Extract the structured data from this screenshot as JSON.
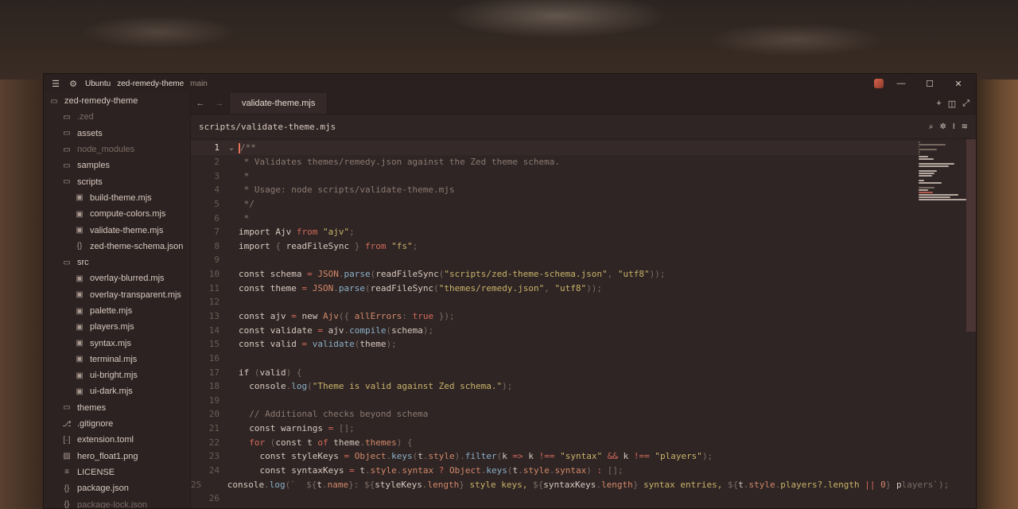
{
  "titlebar": {
    "os": "Ubuntu",
    "project": "zed-remedy-theme",
    "branch": "main"
  },
  "sidebar": {
    "items": [
      {
        "label": "zed-remedy-theme",
        "icon": "folder-open-icon",
        "depth": 0,
        "dim": false
      },
      {
        "label": ".zed",
        "icon": "folder-icon",
        "depth": 1,
        "dim": true
      },
      {
        "label": "assets",
        "icon": "folder-icon",
        "depth": 1,
        "dim": false
      },
      {
        "label": "node_modules",
        "icon": "folder-icon",
        "depth": 1,
        "dim": true
      },
      {
        "label": "samples",
        "icon": "folder-icon",
        "depth": 1,
        "dim": false
      },
      {
        "label": "scripts",
        "icon": "folder-open-icon",
        "depth": 1,
        "dim": false
      },
      {
        "label": "build-theme.mjs",
        "icon": "js-file-icon",
        "depth": 2,
        "dim": false
      },
      {
        "label": "compute-colors.mjs",
        "icon": "js-file-icon",
        "depth": 2,
        "dim": false
      },
      {
        "label": "validate-theme.mjs",
        "icon": "js-file-icon",
        "depth": 2,
        "dim": false
      },
      {
        "label": "zed-theme-schema.json",
        "icon": "json-file-icon",
        "depth": 2,
        "dim": false
      },
      {
        "label": "src",
        "icon": "folder-open-icon",
        "depth": 1,
        "dim": false
      },
      {
        "label": "overlay-blurred.mjs",
        "icon": "js-file-icon",
        "depth": 2,
        "dim": false
      },
      {
        "label": "overlay-transparent.mjs",
        "icon": "js-file-icon",
        "depth": 2,
        "dim": false
      },
      {
        "label": "palette.mjs",
        "icon": "js-file-icon",
        "depth": 2,
        "dim": false
      },
      {
        "label": "players.mjs",
        "icon": "js-file-icon",
        "depth": 2,
        "dim": false
      },
      {
        "label": "syntax.mjs",
        "icon": "js-file-icon",
        "depth": 2,
        "dim": false
      },
      {
        "label": "terminal.mjs",
        "icon": "js-file-icon",
        "depth": 2,
        "dim": false
      },
      {
        "label": "ui-bright.mjs",
        "icon": "js-file-icon",
        "depth": 2,
        "dim": false
      },
      {
        "label": "ui-dark.mjs",
        "icon": "js-file-icon",
        "depth": 2,
        "dim": false
      },
      {
        "label": "themes",
        "icon": "folder-icon",
        "depth": 1,
        "dim": false
      },
      {
        "label": ".gitignore",
        "icon": "git-icon",
        "depth": 1,
        "dim": false
      },
      {
        "label": "extension.toml",
        "icon": "toml-file-icon",
        "depth": 1,
        "dim": false
      },
      {
        "label": "hero_float1.png",
        "icon": "image-file-icon",
        "depth": 1,
        "dim": false
      },
      {
        "label": "LICENSE",
        "icon": "license-file-icon",
        "depth": 1,
        "dim": false
      },
      {
        "label": "package.json",
        "icon": "json-file-icon",
        "depth": 1,
        "dim": false
      },
      {
        "label": "package-lock.json",
        "icon": "json-file-icon",
        "depth": 1,
        "dim": true
      }
    ]
  },
  "tabs": [
    {
      "label": "validate-theme.mjs",
      "active": true
    }
  ],
  "breadcrumb": "scripts/validate-theme.mjs",
  "colors": {
    "keyword": "#d36a5a",
    "string": "#c9b36a",
    "comment": "#8a7a72",
    "func": "#8ab0c8",
    "prop": "#d3896a",
    "plain": "#d8c9c0",
    "punct": "#7b6c65",
    "accent": "#e8735a"
  },
  "code": [
    {
      "n": "1",
      "fold": "chevron-down-icon",
      "tokens": [
        [
          "/**",
          "comment"
        ]
      ]
    },
    {
      "n": "2",
      "tokens": [
        [
          " * Validates themes/remedy.json against the Zed theme schema.",
          "comment"
        ]
      ]
    },
    {
      "n": "3",
      "tokens": [
        [
          " *",
          "comment"
        ]
      ]
    },
    {
      "n": "4",
      "tokens": [
        [
          " * Usage: node scripts/validate-theme.mjs",
          "comment"
        ]
      ]
    },
    {
      "n": "5",
      "tokens": [
        [
          " */",
          "comment"
        ]
      ]
    },
    {
      "n": "6",
      "tokens": [
        [
          " *",
          "comment"
        ]
      ]
    },
    {
      "n": "7",
      "tokens": [
        [
          "import ",
          "plain"
        ],
        [
          "Ajv ",
          "plain"
        ],
        [
          "from ",
          "keyword"
        ],
        [
          "\"ajv\"",
          "string"
        ],
        [
          ";",
          "punct"
        ]
      ]
    },
    {
      "n": "8",
      "tokens": [
        [
          "import ",
          "plain"
        ],
        [
          "{ ",
          "punct"
        ],
        [
          "readFileSync ",
          "plain"
        ],
        [
          "} ",
          "punct"
        ],
        [
          "from ",
          "keyword"
        ],
        [
          "\"fs\"",
          "string"
        ],
        [
          ";",
          "punct"
        ]
      ]
    },
    {
      "n": "9",
      "tokens": []
    },
    {
      "n": "10",
      "tokens": [
        [
          "const ",
          "plain"
        ],
        [
          "schema ",
          "plain"
        ],
        [
          "= ",
          "keyword"
        ],
        [
          "JSON",
          "prop"
        ],
        [
          ".",
          "punct"
        ],
        [
          "parse",
          "func"
        ],
        [
          "(",
          "punct"
        ],
        [
          "readFileSync",
          "plain"
        ],
        [
          "(",
          "punct"
        ],
        [
          "\"scripts/zed-theme-schema.json\"",
          "string"
        ],
        [
          ", ",
          "punct"
        ],
        [
          "\"utf8\"",
          "string"
        ],
        [
          "));",
          "punct"
        ]
      ]
    },
    {
      "n": "11",
      "tokens": [
        [
          "const ",
          "plain"
        ],
        [
          "theme ",
          "plain"
        ],
        [
          "= ",
          "keyword"
        ],
        [
          "JSON",
          "prop"
        ],
        [
          ".",
          "punct"
        ],
        [
          "parse",
          "func"
        ],
        [
          "(",
          "punct"
        ],
        [
          "readFileSync",
          "plain"
        ],
        [
          "(",
          "punct"
        ],
        [
          "\"themes/remedy.json\"",
          "string"
        ],
        [
          ", ",
          "punct"
        ],
        [
          "\"utf8\"",
          "string"
        ],
        [
          "));",
          "punct"
        ]
      ]
    },
    {
      "n": "12",
      "tokens": []
    },
    {
      "n": "13",
      "tokens": [
        [
          "const ",
          "plain"
        ],
        [
          "ajv ",
          "plain"
        ],
        [
          "= ",
          "keyword"
        ],
        [
          "new ",
          "plain"
        ],
        [
          "Ajv",
          "prop"
        ],
        [
          "({ ",
          "punct"
        ],
        [
          "allErrors",
          "prop"
        ],
        [
          ": ",
          "punct"
        ],
        [
          "true ",
          "keyword"
        ],
        [
          "});",
          "punct"
        ]
      ]
    },
    {
      "n": "14",
      "tokens": [
        [
          "const ",
          "plain"
        ],
        [
          "validate ",
          "plain"
        ],
        [
          "= ",
          "keyword"
        ],
        [
          "ajv",
          "plain"
        ],
        [
          ".",
          "punct"
        ],
        [
          "compile",
          "func"
        ],
        [
          "(",
          "punct"
        ],
        [
          "schema",
          "plain"
        ],
        [
          ");",
          "punct"
        ]
      ]
    },
    {
      "n": "15",
      "tokens": [
        [
          "const ",
          "plain"
        ],
        [
          "valid ",
          "plain"
        ],
        [
          "= ",
          "keyword"
        ],
        [
          "validate",
          "func"
        ],
        [
          "(",
          "punct"
        ],
        [
          "theme",
          "plain"
        ],
        [
          ");",
          "punct"
        ]
      ]
    },
    {
      "n": "16",
      "tokens": []
    },
    {
      "n": "17",
      "tokens": [
        [
          "if ",
          "plain"
        ],
        [
          "(",
          "punct"
        ],
        [
          "valid",
          "plain"
        ],
        [
          ") {",
          "punct"
        ]
      ]
    },
    {
      "n": "18",
      "tokens": [
        [
          "  console",
          "plain"
        ],
        [
          ".",
          "punct"
        ],
        [
          "log",
          "func"
        ],
        [
          "(",
          "punct"
        ],
        [
          "\"Theme is valid against Zed schema.\"",
          "string"
        ],
        [
          ");",
          "punct"
        ]
      ]
    },
    {
      "n": "19",
      "tokens": []
    },
    {
      "n": "20",
      "tokens": [
        [
          "  // Additional checks beyond schema",
          "comment"
        ]
      ]
    },
    {
      "n": "21",
      "tokens": [
        [
          "  const ",
          "plain"
        ],
        [
          "warnings ",
          "plain"
        ],
        [
          "= ",
          "keyword"
        ],
        [
          "[];",
          "punct"
        ]
      ]
    },
    {
      "n": "22",
      "tokens": [
        [
          "  for ",
          "keyword"
        ],
        [
          "(",
          "punct"
        ],
        [
          "const ",
          "plain"
        ],
        [
          "t ",
          "plain"
        ],
        [
          "of ",
          "keyword"
        ],
        [
          "theme",
          "plain"
        ],
        [
          ".",
          "punct"
        ],
        [
          "themes",
          "prop"
        ],
        [
          ") {",
          "punct"
        ]
      ]
    },
    {
      "n": "23",
      "tokens": [
        [
          "    const ",
          "plain"
        ],
        [
          "styleKeys ",
          "plain"
        ],
        [
          "= ",
          "keyword"
        ],
        [
          "Object",
          "prop"
        ],
        [
          ".",
          "punct"
        ],
        [
          "keys",
          "func"
        ],
        [
          "(",
          "punct"
        ],
        [
          "t",
          "plain"
        ],
        [
          ".",
          "punct"
        ],
        [
          "style",
          "prop"
        ],
        [
          ").",
          "punct"
        ],
        [
          "filter",
          "func"
        ],
        [
          "(",
          "punct"
        ],
        [
          "k ",
          "plain"
        ],
        [
          "=> ",
          "keyword"
        ],
        [
          "k ",
          "plain"
        ],
        [
          "!== ",
          "keyword"
        ],
        [
          "\"syntax\" ",
          "string"
        ],
        [
          "&& ",
          "keyword"
        ],
        [
          "k ",
          "plain"
        ],
        [
          "!== ",
          "keyword"
        ],
        [
          "\"players\"",
          "string"
        ],
        [
          ");",
          "punct"
        ]
      ]
    },
    {
      "n": "24",
      "tokens": [
        [
          "    const ",
          "plain"
        ],
        [
          "syntaxKeys ",
          "plain"
        ],
        [
          "= ",
          "keyword"
        ],
        [
          "t",
          "plain"
        ],
        [
          ".",
          "punct"
        ],
        [
          "style",
          "prop"
        ],
        [
          ".",
          "punct"
        ],
        [
          "syntax ",
          "prop"
        ],
        [
          "? ",
          "keyword"
        ],
        [
          "Object",
          "prop"
        ],
        [
          ".",
          "punct"
        ],
        [
          "keys",
          "func"
        ],
        [
          "(",
          "punct"
        ],
        [
          "t",
          "plain"
        ],
        [
          ".",
          "punct"
        ],
        [
          "style",
          "prop"
        ],
        [
          ".",
          "punct"
        ],
        [
          "syntax",
          "prop"
        ],
        [
          ") ",
          "punct"
        ],
        [
          ": ",
          "keyword"
        ],
        [
          "[];",
          "punct"
        ]
      ]
    },
    {
      "n": "25",
      "tokens": [
        [
          "    console",
          "plain"
        ],
        [
          ".",
          "punct"
        ],
        [
          "log",
          "func"
        ],
        [
          "(`  ",
          "punct"
        ],
        [
          "${",
          "punct"
        ],
        [
          "t",
          "plain"
        ],
        [
          ".",
          "punct"
        ],
        [
          "name",
          "prop"
        ],
        [
          "}: ",
          "punct"
        ],
        [
          "${",
          "punct"
        ],
        [
          "styleKeys",
          "plain"
        ],
        [
          ".",
          "punct"
        ],
        [
          "length",
          "prop"
        ],
        [
          "} ",
          "punct"
        ],
        [
          "style keys, ",
          "string"
        ],
        [
          "${",
          "punct"
        ],
        [
          "syntaxKeys",
          "plain"
        ],
        [
          ".",
          "punct"
        ],
        [
          "length",
          "prop"
        ],
        [
          "} ",
          "punct"
        ],
        [
          "syntax entries, ",
          "string"
        ],
        [
          "${",
          "punct"
        ],
        [
          "t",
          "plain"
        ],
        [
          ".",
          "punct"
        ],
        [
          "style",
          "prop"
        ],
        [
          ".",
          "punct"
        ],
        [
          "players?.length ",
          "string"
        ],
        [
          "|| ",
          "keyword"
        ],
        [
          "0",
          "prop"
        ],
        [
          "} ",
          "punct"
        ],
        [
          "p",
          "plain"
        ],
        [
          "layers`);",
          "punct"
        ]
      ]
    },
    {
      "n": "26",
      "tokens": []
    }
  ]
}
